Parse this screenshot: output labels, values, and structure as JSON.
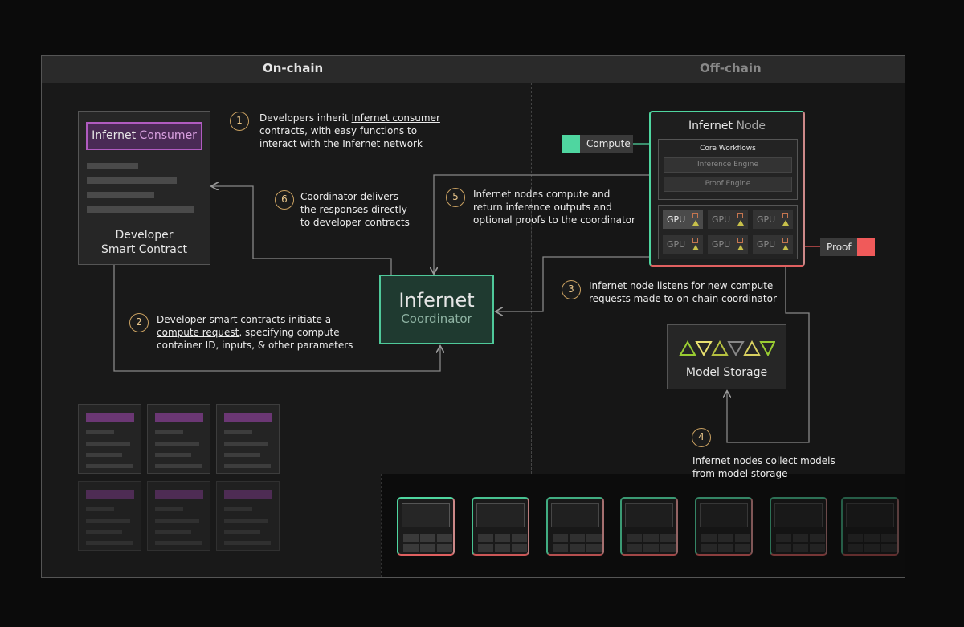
{
  "sections": {
    "onchain": "On-chain",
    "offchain": "Off-chain"
  },
  "developer": {
    "consumer_brand": "Infernet",
    "consumer_word": "Consumer",
    "title_line1": "Developer",
    "title_line2": "Smart Contract"
  },
  "coordinator": {
    "line1": "Infernet",
    "line2": "Coordinator"
  },
  "node": {
    "brand": "Infernet",
    "word": "Node",
    "core": "Core Workflows",
    "engines": [
      "Inference Engine",
      "Proof Engine"
    ],
    "gpu_label": "GPU"
  },
  "compute_label": "Compute",
  "proof_label": "Proof",
  "model_storage": "Model Storage",
  "steps": [
    {
      "n": "1",
      "pre": "Developers inherit ",
      "link": "Infernet consumer",
      "l2": "contracts, with easy functions to",
      "l3": "interact with the Infernet network"
    },
    {
      "n": "2",
      "l1": "Developer smart contracts initiate a",
      "link": "compute request",
      "post": ", specifying compute",
      "l3": "container ID, inputs, & other parameters"
    },
    {
      "n": "3",
      "l1": "Infernet node listens for new compute",
      "l2": "requests made to on-chain coordinator"
    },
    {
      "n": "4",
      "l1": "Infernet nodes collect models",
      "l2": "from model storage"
    },
    {
      "n": "5",
      "l1": "Infernet nodes compute and",
      "l2": "return inference outputs and",
      "l3": "optional proofs to the coordinator"
    },
    {
      "n": "6",
      "l1": "Coordinator delivers",
      "l2": "the responses directly",
      "l3": "to developer contracts"
    }
  ],
  "colors": {
    "accent_green": "#4fd6a0",
    "proof_red": "#f05a5a",
    "consumer_purple": "#b05bc0",
    "step_gold": "#c9a060"
  }
}
